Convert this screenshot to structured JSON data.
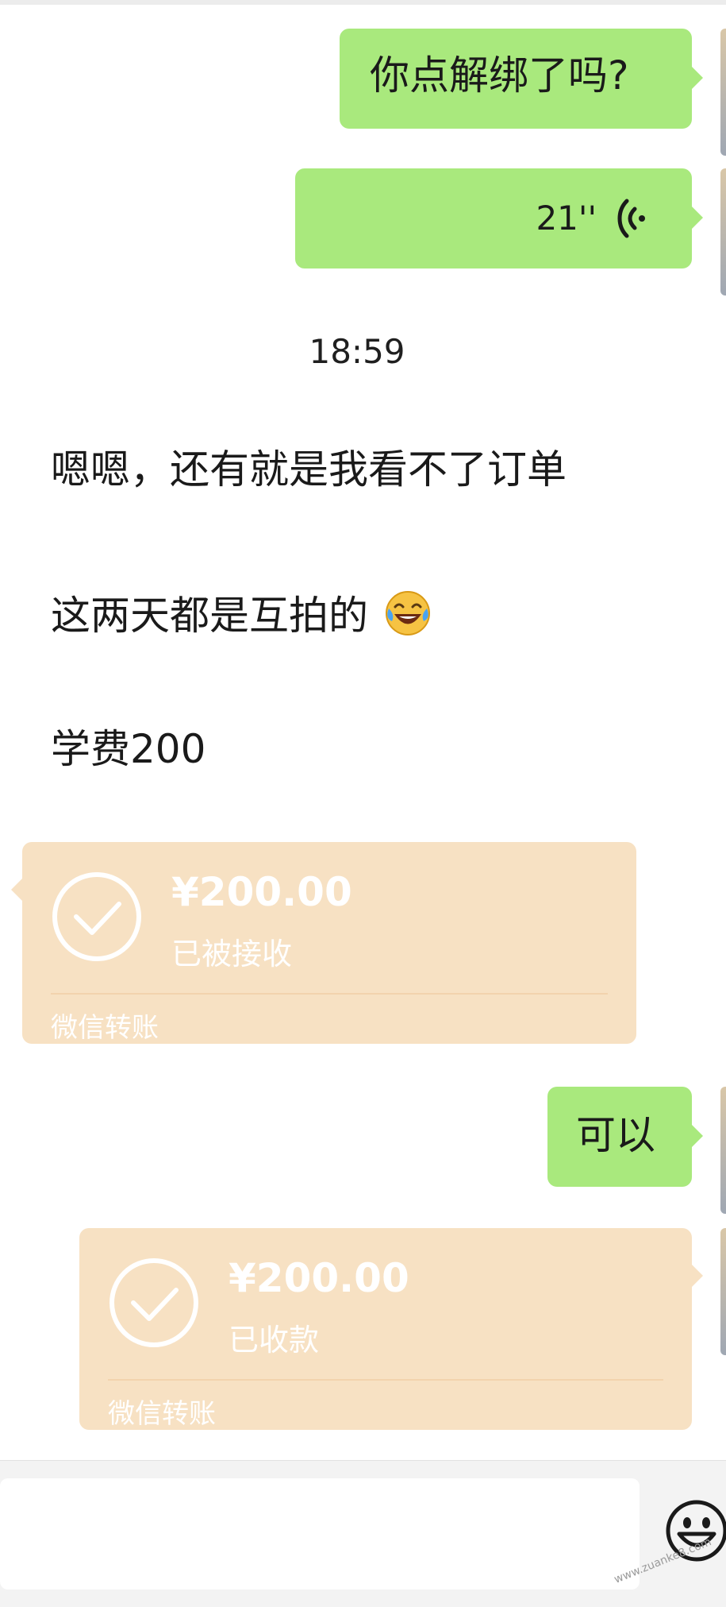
{
  "messages": {
    "m1": {
      "text": "你点解绑了吗?"
    },
    "m2": {
      "duration": "21''"
    },
    "timestamp": "18:59",
    "m3": {
      "text": "嗯嗯，还有就是我看不了订单"
    },
    "m4": {
      "text": "这两天都是互拍的",
      "emoji": "tears-of-joy-emoji"
    },
    "m5": {
      "text": "学费200"
    },
    "t1": {
      "amount": "¥200.00",
      "status": "已被接收",
      "brand": "微信转账"
    },
    "m6": {
      "text": "可以"
    },
    "t2": {
      "amount": "¥200.00",
      "status": "已收款",
      "brand": "微信转账"
    }
  },
  "watermark": "www.zuanke8.com",
  "colors": {
    "sent_bubble": "#a9e97d",
    "transfer_card": "#f7e1c3",
    "background": "#ffffff"
  }
}
